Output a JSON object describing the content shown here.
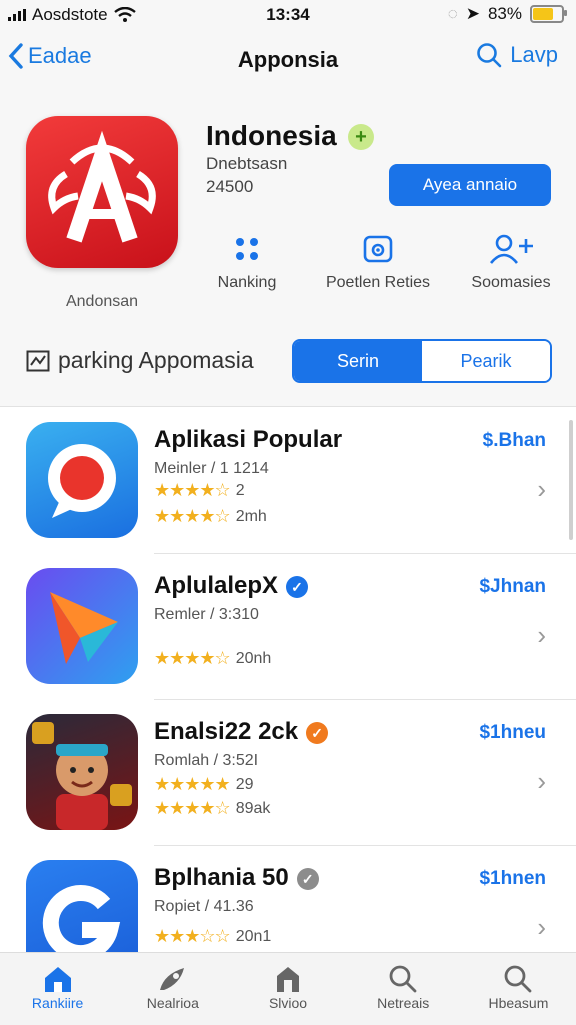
{
  "status_bar": {
    "carrier": "Aosdstote",
    "time": "13:34",
    "battery": "83%",
    "battery_level": 0.83
  },
  "nav": {
    "back_label": "Eadae",
    "title": "Apponsia",
    "search_label": "Lavp"
  },
  "app": {
    "name": "Indonesia",
    "icon_caption": "Andonsan",
    "developer": "Dnebtsasn",
    "count": "24500",
    "get_label": "Ayea annaio",
    "stats": [
      {
        "label": "Nanking",
        "icon": "dots-icon"
      },
      {
        "label": "Poetlen Reties",
        "icon": "camera-icon"
      },
      {
        "label": "Soomasies",
        "icon": "person-add-icon"
      }
    ],
    "section_label": "parking Appomasia",
    "segments": [
      "Serin",
      "Pearik"
    ],
    "segment_selected": 0
  },
  "list": [
    {
      "name": "Aplikasi Popular",
      "sub": "Meinler / 1 1214",
      "rating_a": 4,
      "rating_a_text": "2",
      "rating_b": 4,
      "rating_b_text": "2mh",
      "price": "$.Bhan",
      "verified_color": ""
    },
    {
      "name": "AplulalepX",
      "sub": "Remler / 3:310",
      "rating_a": null,
      "rating_a_text": "",
      "rating_b": 4,
      "rating_b_text": "20nh",
      "price": "$Jhnan",
      "verified_color": "#1a73e8"
    },
    {
      "name": "Enalsi22 2ck",
      "sub": "Romlah / 3:52I",
      "rating_a": 5,
      "rating_a_text": "29",
      "rating_b": 4,
      "rating_b_text": "89ak",
      "price": "$1hneu",
      "verified_color": "#f07a1e"
    },
    {
      "name": "Bplhania 50",
      "sub": "Ropiet / 41.36",
      "rating_a": null,
      "rating_a_text": "",
      "rating_b": 3,
      "rating_b_text": "20n1",
      "price": "$1hnen",
      "verified_color": "#8c8c8c"
    }
  ],
  "tabs": [
    {
      "label": "Rankiire",
      "icon": "appstore-icon"
    },
    {
      "label": "Nealrioa",
      "icon": "rocket-icon"
    },
    {
      "label": "Slvioo",
      "icon": "game-icon"
    },
    {
      "label": "Netreais",
      "icon": "search-icon"
    },
    {
      "label": "Hbeasum",
      "icon": "search-icon"
    }
  ],
  "active_tab": 0,
  "colors": {
    "accent": "#1a73e8",
    "icon_red": "#e3232a",
    "star": "#f2b01e"
  }
}
